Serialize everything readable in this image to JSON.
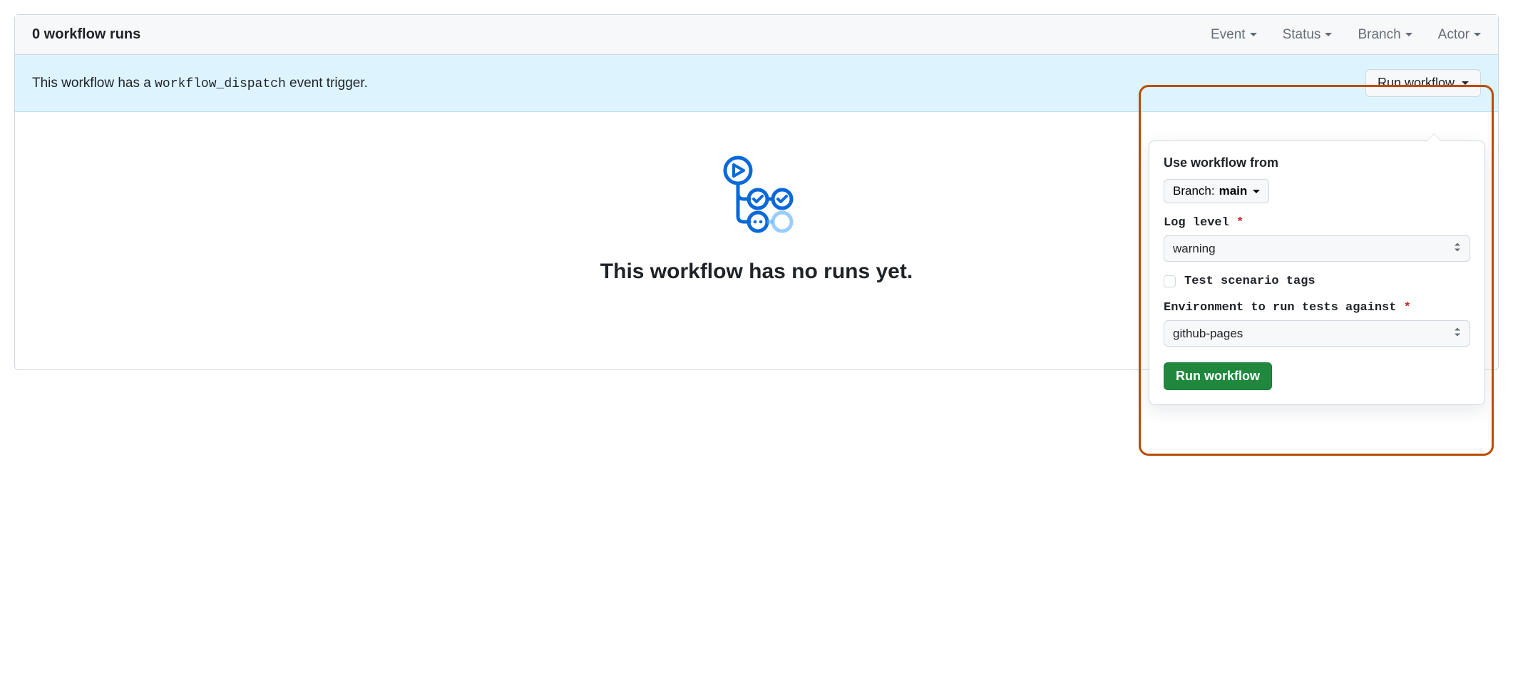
{
  "header": {
    "runs_label": "0 workflow runs",
    "filters": {
      "event": "Event",
      "status": "Status",
      "branch": "Branch",
      "actor": "Actor"
    }
  },
  "banner": {
    "prefix": "This workflow has a ",
    "code": "workflow_dispatch",
    "suffix": " event trigger.",
    "run_btn": "Run workflow"
  },
  "empty": {
    "title": "This workflow has no runs yet."
  },
  "popover": {
    "use_from_label": "Use workflow from",
    "branch_prefix": "Branch: ",
    "branch_value": "main",
    "log_level_label": "Log level",
    "log_level_value": "warning",
    "test_tags_label": "Test scenario tags",
    "env_label": "Environment to run tests against",
    "env_value": "github-pages",
    "submit_label": "Run workflow"
  }
}
